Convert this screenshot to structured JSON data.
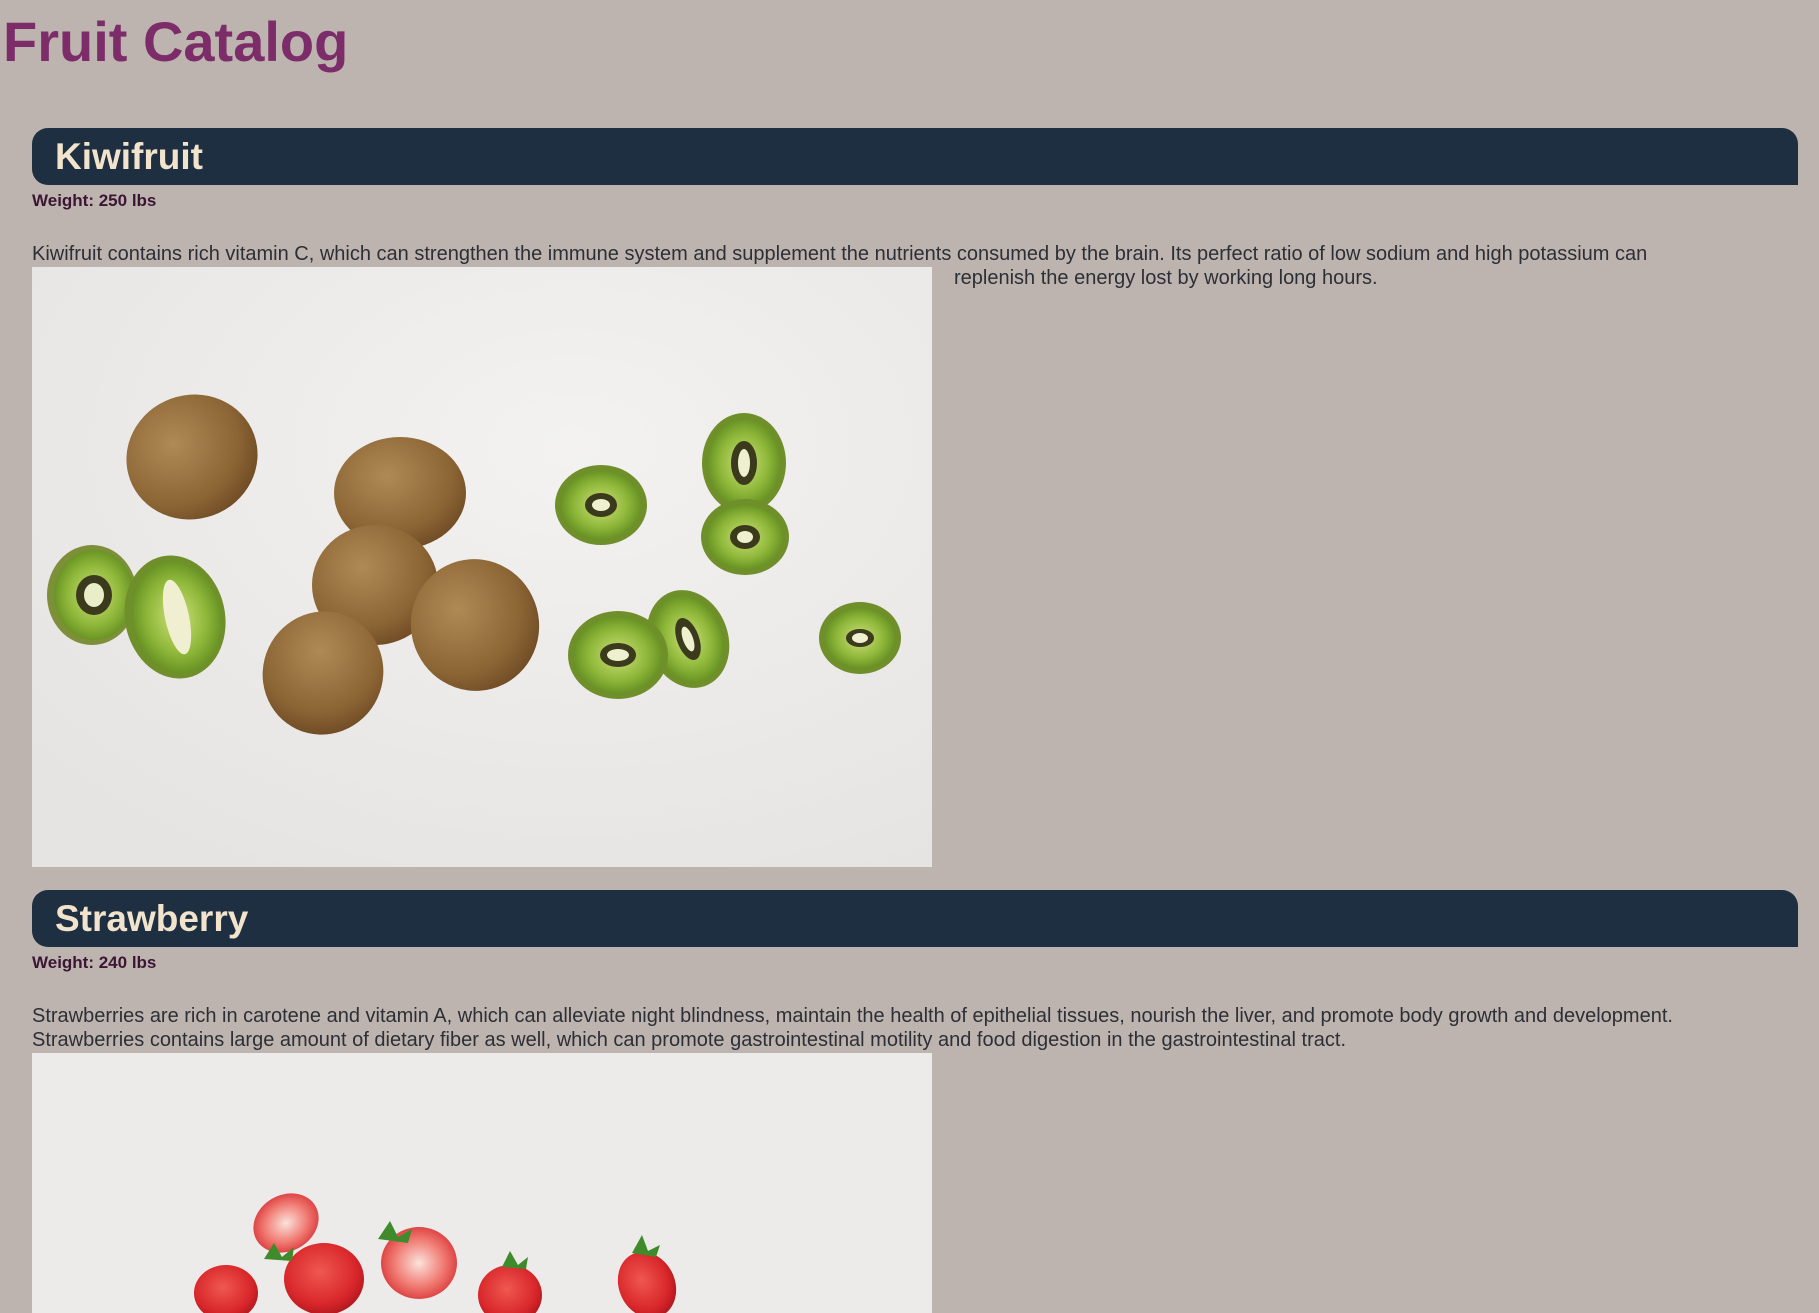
{
  "page": {
    "title": "Fruit Catalog",
    "background_color": "#beb4af",
    "title_color": "#7b2c69",
    "header_color": "#1d2f41"
  },
  "fruits": [
    {
      "name": "Kiwifruit",
      "weight": "Weight: 250 lbs",
      "description_line1": "Kiwifruit contains rich vitamin C, which can strengthen the immune system and supplement the nutrients consumed by the brain. Its perfect ratio of low sodium and high potassium can",
      "description_line2": "replenish the energy lost by working long hours.",
      "image": "kiwifruit-photo"
    },
    {
      "name": "Strawberry",
      "weight": "Weight: 240 lbs",
      "description_line1": "Strawberries are rich in carotene and vitamin A, which can alleviate night blindness, maintain the health of epithelial tissues, nourish the liver, and promote body growth and development.",
      "description_line2": "Strawberries contains large amount of dietary fiber as well, which can promote gastrointestinal motility and food digestion in the gastrointestinal tract.",
      "image": "strawberry-photo"
    }
  ]
}
